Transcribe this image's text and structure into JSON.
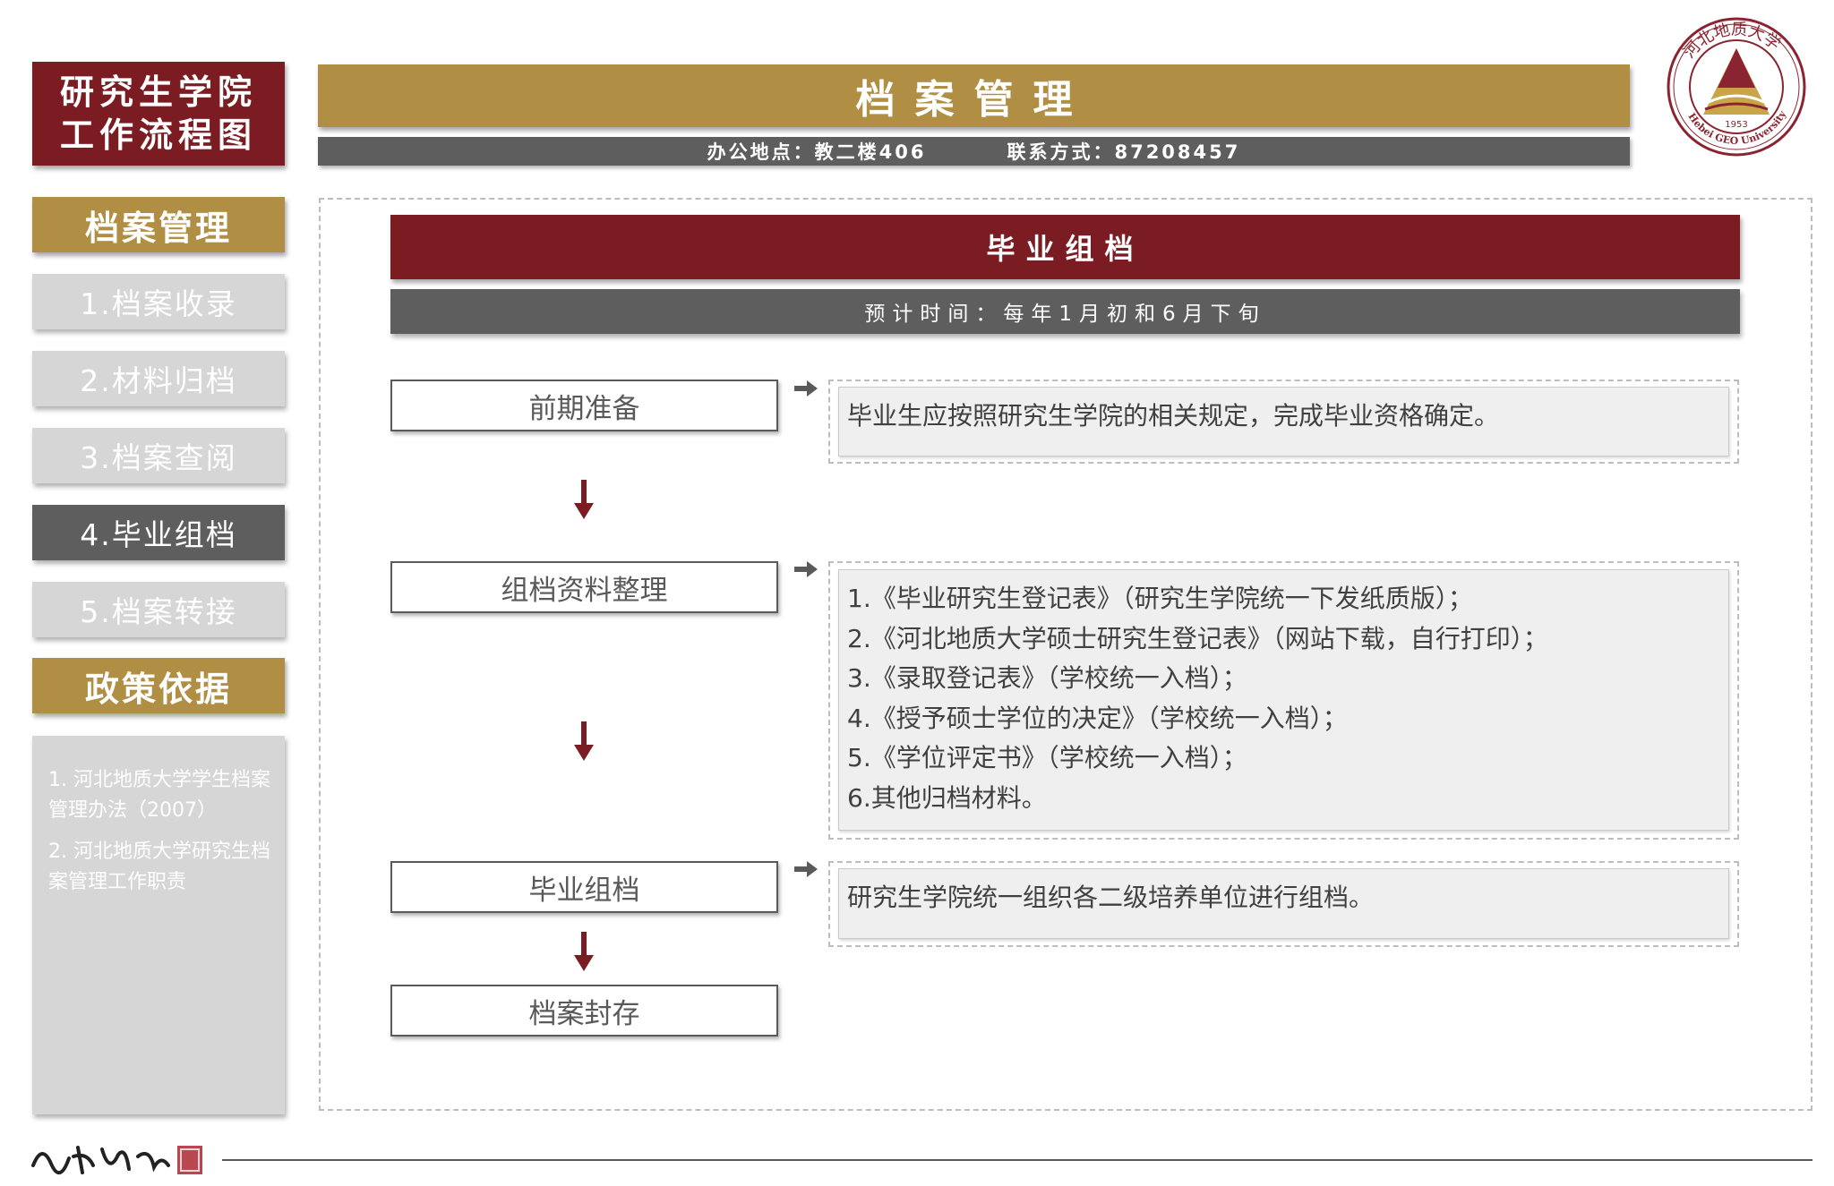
{
  "brand": {
    "line1": "研究生学院",
    "line2": "工作流程图"
  },
  "sidebar": {
    "section_archive": "档案管理",
    "items": [
      {
        "label": "1.档案收录",
        "active": false
      },
      {
        "label": "2.材料归档",
        "active": false
      },
      {
        "label": "3.档案查阅",
        "active": false
      },
      {
        "label": "4.毕业组档",
        "active": true
      },
      {
        "label": "5.档案转接",
        "active": false
      }
    ],
    "section_policy": "政策依据",
    "policies": [
      "1. 河北地质大学学生档案管理办法（2007）",
      "2. 河北地质大学研究生档案管理工作职责"
    ]
  },
  "header": {
    "title": "档案管理",
    "office": "办公地点：教二楼406",
    "contact": "联系方式：87208457"
  },
  "logo": {
    "name": "Hebei GEO University",
    "chinese": "河北地质大学",
    "year": "1953"
  },
  "section": {
    "title": "毕业组档",
    "time": "预计时间：每年1月初和6月下旬"
  },
  "steps": [
    {
      "label": "前期准备",
      "notes": [
        "毕业生应按照研究生学院的相关规定，完成毕业资格确定。"
      ]
    },
    {
      "label": "组档资料整理",
      "notes": [
        "1.《毕业研究生登记表》（研究生学院统一下发纸质版）；",
        "2.《河北地质大学硕士研究生登记表》（网站下载，自行打印）；",
        "3.《录取登记表》（学校统一入档）；",
        "4.《授予硕士学位的决定》（学校统一入档）；",
        "5.《学位评定书》（学校统一入档）；",
        "6.其他归档材料。"
      ]
    },
    {
      "label": "毕业组档",
      "notes": [
        "研究生学院统一组织各二级培养单位进行组档。"
      ]
    },
    {
      "label": "档案封存",
      "notes": []
    }
  ],
  "colors": {
    "maroon": "#7b1b22",
    "gold": "#b08e44",
    "dark_gray": "#5e5e5e",
    "light_gray": "#d6d6d6"
  },
  "icons": [
    "down-arrow-icon",
    "right-arrow-icon",
    "university-seal-logo",
    "signature-stamp"
  ]
}
